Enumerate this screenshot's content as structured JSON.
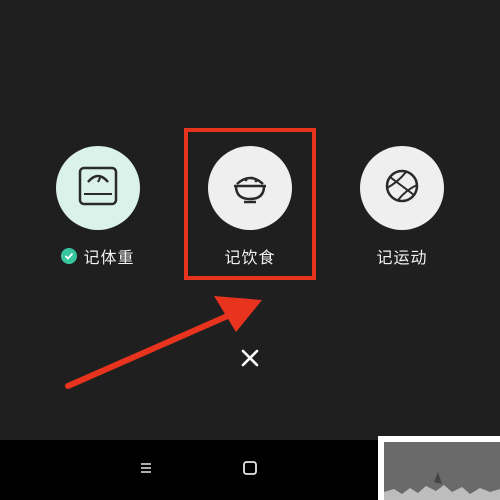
{
  "actions": {
    "weight": {
      "label": "记体重",
      "icon": "scale-icon",
      "checked": true
    },
    "food": {
      "label": "记饮食",
      "icon": "rice-bowl-icon"
    },
    "exercise": {
      "label": "记运动",
      "icon": "basketball-icon"
    }
  },
  "close": {
    "icon": "close-icon"
  },
  "navbar": {
    "menu_icon": "menu-icon",
    "home_icon": "home-icon"
  },
  "colors": {
    "background": "#1f1f1f",
    "mint": "#daf2ea",
    "light": "#efefef",
    "accent_check": "#37c6a0",
    "annotation_red": "#e8341f"
  }
}
